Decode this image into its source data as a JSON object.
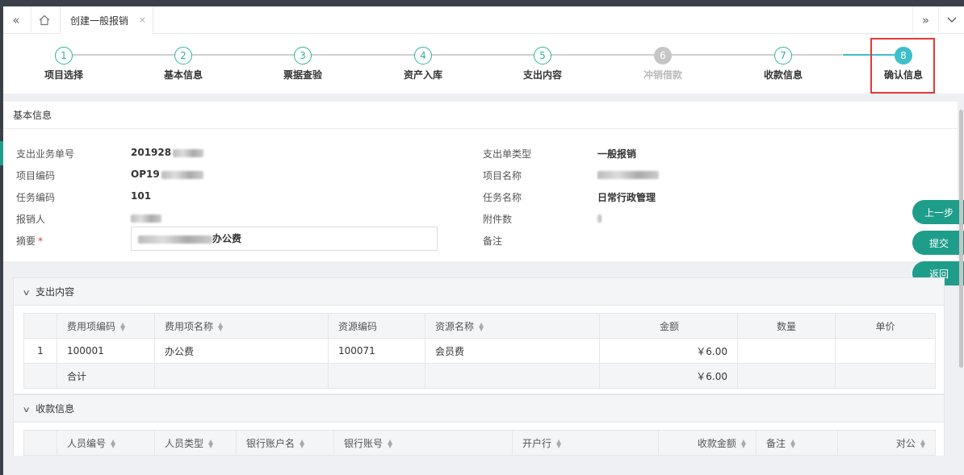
{
  "tabbar": {
    "collapse_left_icon": "double-chevron-left-icon",
    "home_icon": "home-icon",
    "active_tab": "创建一般报销",
    "close_glyph": "×",
    "collapse_right_icon": "double-chevron-right-icon",
    "menu_icon": "chevron-down-icon"
  },
  "steps": [
    {
      "num": "1",
      "label": "项目选择",
      "state": "done"
    },
    {
      "num": "2",
      "label": "基本信息",
      "state": "done"
    },
    {
      "num": "3",
      "label": "票据查验",
      "state": "done"
    },
    {
      "num": "4",
      "label": "资产入库",
      "state": "done"
    },
    {
      "num": "5",
      "label": "支出内容",
      "state": "done"
    },
    {
      "num": "6",
      "label": "冲销借款",
      "state": "disabled"
    },
    {
      "num": "7",
      "label": "收款信息",
      "state": "done"
    },
    {
      "num": "8",
      "label": "确认信息",
      "state": "current"
    }
  ],
  "basic": {
    "title": "基本信息",
    "left": [
      {
        "label": "支出业务单号",
        "value": "201928"
      },
      {
        "label": "项目编码",
        "value": "OP19"
      },
      {
        "label": "任务编码",
        "value": "101"
      },
      {
        "label": "报销人",
        "value": ""
      }
    ],
    "right": [
      {
        "label": "支出单类型",
        "value": "一般报销"
      },
      {
        "label": "项目名称",
        "value": ""
      },
      {
        "label": "任务名称",
        "value": "日常行政管理"
      },
      {
        "label": "附件数",
        "value": ""
      },
      {
        "label": "备注",
        "value": ""
      }
    ],
    "summary_label": "摘要",
    "required_mark": "*",
    "summary_value": "办公费"
  },
  "side_buttons": {
    "prev": "上一步",
    "submit": "提交",
    "back": "返回"
  },
  "expense": {
    "title": "支出内容",
    "columns": [
      "",
      "费用项编码",
      "费用项名称",
      "资源编码",
      "资源名称",
      "金额",
      "数量",
      "单价"
    ],
    "rows": [
      [
        "1",
        "100001",
        "办公费",
        "100071",
        "会员费",
        "￥6.00",
        "",
        ""
      ]
    ],
    "total": [
      "",
      "合计",
      "",
      "",
      "",
      "￥6.00",
      "",
      ""
    ]
  },
  "payee": {
    "title": "收款信息",
    "columns": [
      "",
      "人员编号",
      "人员类型",
      "银行账户名",
      "银行账号",
      "开户行",
      "收款金额",
      "备注",
      "对公"
    ]
  },
  "colors": {
    "accent": "#1e9d8b",
    "step_active": "#3bbfc9",
    "highlight": "#e53935"
  }
}
